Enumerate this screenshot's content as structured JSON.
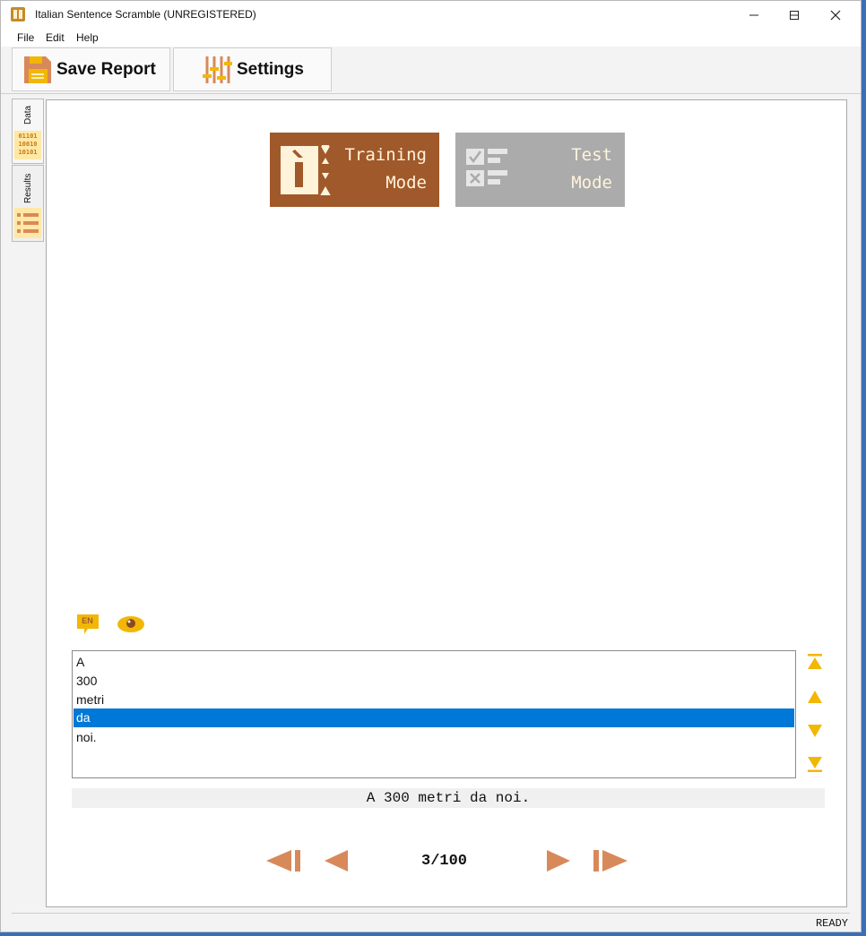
{
  "window": {
    "title": "Italian Sentence Scramble (UNREGISTERED)"
  },
  "menu": {
    "items": [
      "File",
      "Edit",
      "Help"
    ]
  },
  "toolbar": {
    "save_label": "Save Report",
    "settings_label": "Settings"
  },
  "sidebar": {
    "tabs": [
      {
        "label": "Data",
        "icon": "binary-data-icon",
        "icon_text": [
          "01101",
          "10010",
          "10101"
        ]
      },
      {
        "label": "Results",
        "icon": "list-icon"
      }
    ]
  },
  "modes": {
    "training": {
      "line1": "Training",
      "line2": "Mode",
      "active": true
    },
    "test": {
      "line1": "Test",
      "line2": "Mode",
      "active": false
    }
  },
  "tools": {
    "translation_badge": "EN"
  },
  "words": {
    "items": [
      "A",
      "300",
      "metri",
      "da",
      "noi."
    ],
    "selected_index": 3
  },
  "sentence": "A 300 metri da noi.",
  "pager": {
    "current": 3,
    "total": 100,
    "display": "3/100"
  },
  "status": "READY",
  "colors": {
    "accent": "#a0592a",
    "inactive": "#ababab",
    "arrow": "#f2b705",
    "nav": "#d8895a",
    "selection": "#0078d7"
  }
}
